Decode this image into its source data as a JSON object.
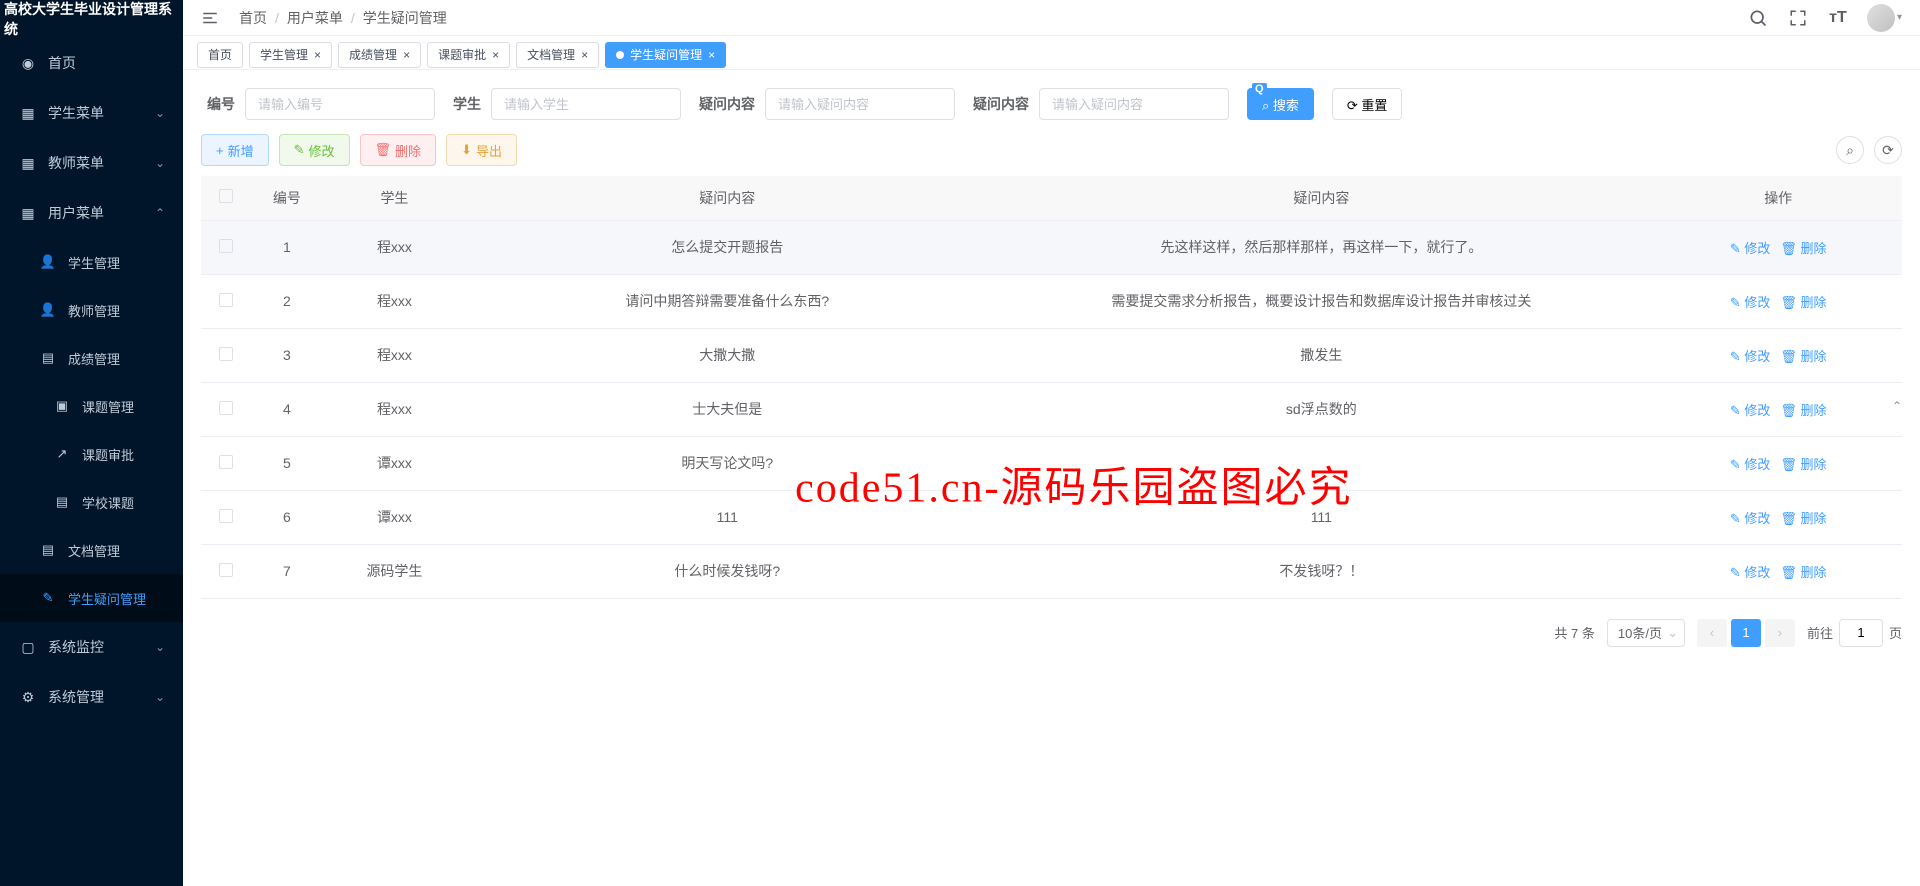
{
  "app_title": "高校大学生毕业设计管理系统",
  "breadcrumb": [
    "首页",
    "用户菜单",
    "学生疑问管理"
  ],
  "header": {
    "search_icon": "search",
    "fullscreen_icon": "fullscreen",
    "fontsize_icon": "fontsize"
  },
  "sidebar": [
    {
      "label": "首页",
      "icon": "dashboard"
    },
    {
      "label": "学生菜单",
      "icon": "menu",
      "expandable": true,
      "open": false
    },
    {
      "label": "教师菜单",
      "icon": "menu",
      "expandable": true,
      "open": false
    },
    {
      "label": "用户菜单",
      "icon": "menu",
      "expandable": true,
      "open": true,
      "children": [
        {
          "label": "学生管理",
          "icon": "user"
        },
        {
          "label": "教师管理",
          "icon": "user"
        },
        {
          "label": "成绩管理",
          "icon": "doc"
        },
        {
          "label": "课题管理",
          "icon": "folder",
          "expandable": true,
          "open": true,
          "children": [
            {
              "label": "课题审批",
              "icon": "link"
            },
            {
              "label": "学校课题",
              "icon": "doc"
            }
          ]
        },
        {
          "label": "文档管理",
          "icon": "doc"
        },
        {
          "label": "学生疑问管理",
          "icon": "edit",
          "active": true
        }
      ]
    },
    {
      "label": "系统监控",
      "icon": "monitor",
      "expandable": true,
      "open": false
    },
    {
      "label": "系统管理",
      "icon": "gear",
      "expandable": true,
      "open": false
    }
  ],
  "tabs": [
    {
      "label": "首页",
      "closable": false
    },
    {
      "label": "学生管理",
      "closable": true
    },
    {
      "label": "成绩管理",
      "closable": true
    },
    {
      "label": "课题审批",
      "closable": true
    },
    {
      "label": "文档管理",
      "closable": true
    },
    {
      "label": "学生疑问管理",
      "closable": true,
      "active": true
    }
  ],
  "search": {
    "fields": [
      {
        "label": "编号",
        "placeholder": "请输入编号"
      },
      {
        "label": "学生",
        "placeholder": "请输入学生"
      },
      {
        "label": "疑问内容",
        "placeholder": "请输入疑问内容"
      },
      {
        "label": "疑问内容",
        "placeholder": "请输入疑问内容"
      }
    ],
    "search_btn": "搜索",
    "reset_btn": "重置"
  },
  "actions": {
    "add": "新增",
    "edit": "修改",
    "delete": "删除",
    "export": "导出"
  },
  "table": {
    "columns": [
      "",
      "编号",
      "学生",
      "疑问内容",
      "疑问内容",
      "操作"
    ],
    "row_edit": "修改",
    "row_delete": "删除",
    "rows": [
      {
        "id": "1",
        "student": "程xxx",
        "q1": "怎么提交开题报告",
        "q2": "先这样这样，然后那样那样，再这样一下，就行了。"
      },
      {
        "id": "2",
        "student": "程xxx",
        "q1": "请问中期答辩需要准备什么东西?",
        "q2": "需要提交需求分析报告，概要设计报告和数据库设计报告并审核过关"
      },
      {
        "id": "3",
        "student": "程xxx",
        "q1": "大撒大撒",
        "q2": "撒发生"
      },
      {
        "id": "4",
        "student": "程xxx",
        "q1": "士大夫但是",
        "q2": "sd浮点数的"
      },
      {
        "id": "5",
        "student": "谭xxx",
        "q1": "明天写论文吗?",
        "q2": ""
      },
      {
        "id": "6",
        "student": "谭xxx",
        "q1": "111",
        "q2": "111"
      },
      {
        "id": "7",
        "student": "源码学生",
        "q1": "什么时候发钱呀?",
        "q2": "不发钱呀？！"
      }
    ]
  },
  "pagination": {
    "total_text": "共 7 条",
    "page_size": "10条/页",
    "current": "1",
    "jump_prefix": "前往",
    "jump_value": "1",
    "jump_suffix": "页"
  },
  "watermark": "code51.cn-源码乐园盗图必究"
}
